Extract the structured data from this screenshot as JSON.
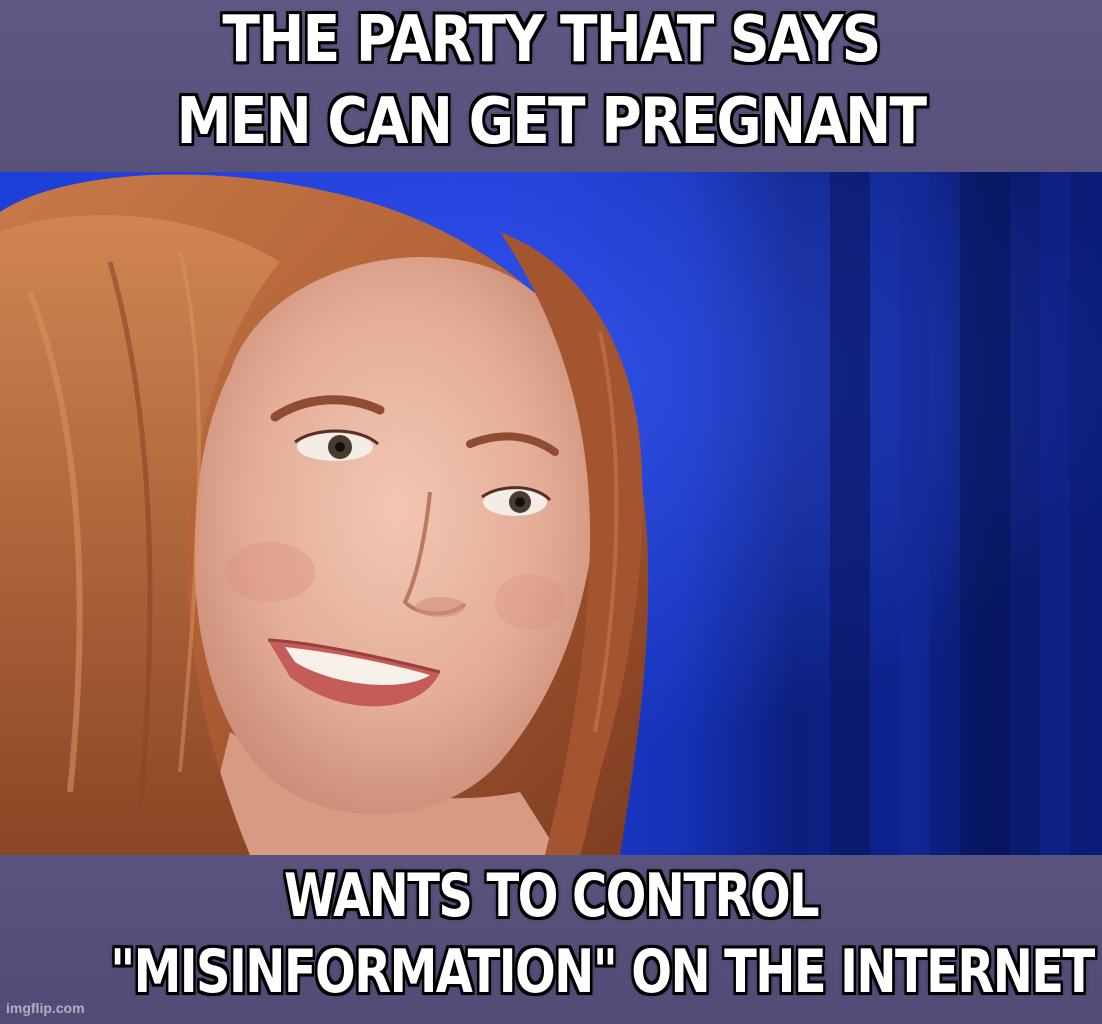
{
  "meme": {
    "top_text": {
      "line1": "THE PARTY THAT SAYS",
      "line2": "MEN CAN GET PREGNANT"
    },
    "bottom_text": {
      "line1": "WANTS TO CONTROL",
      "line2": "\"MISINFORMATION\" ON THE INTERNET"
    },
    "watermark": "imgflip.com"
  },
  "colors": {
    "band": "#5a547c",
    "background_blue": "#1f3ed6",
    "hair": "#b9673a",
    "skin": "#e9b8a4",
    "caption_text": "#ffffff",
    "caption_outline": "#000000"
  },
  "image": {
    "subject": "woman-smiling-portrait"
  }
}
